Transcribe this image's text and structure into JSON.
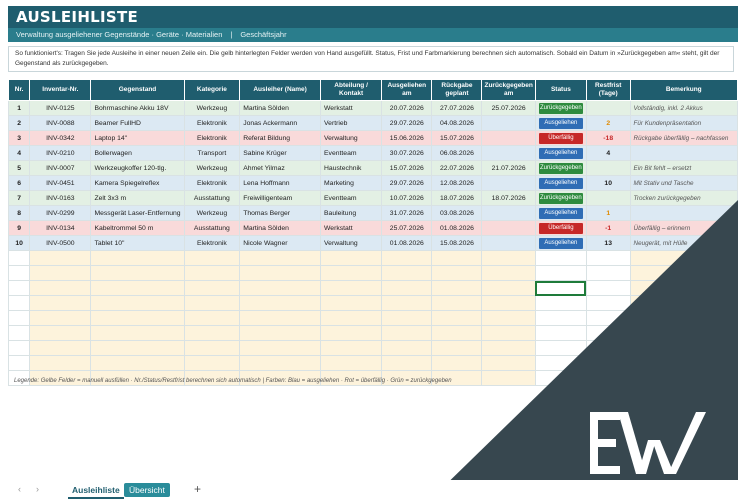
{
  "title": "AUSLEIHLISTE",
  "subtitle": "Verwaltung ausgeliehener Gegenstände · Geräte · Materialien",
  "subtitle_sep": "|",
  "subtitle_extra": "Geschäftsjahr",
  "howto": "So funktioniert's: Tragen Sie jede Ausleihe in einer neuen Zeile ein. Die gelb hinterlegten Felder werden von Hand ausgefüllt. Status, Frist und Farbmarkierung berechnen sich automatisch. Sobald ein Datum in »Zurückgegeben am« steht, gilt der Gegenstand als zurückgegeben.",
  "headers": [
    "Nr.",
    "Inventar-Nr.",
    "Gegenstand",
    "Kategorie",
    "Ausleiher (Name)",
    "Abteilung / Kontakt",
    "Ausgeliehen am",
    "Rückgabe geplant",
    "Zurückgegeben am",
    "Status",
    "Restfrist (Tage)",
    "Bemerkung"
  ],
  "rows": [
    {
      "nr": "1",
      "inv": "INV-0125",
      "item": "Bohrmaschine Akku 18V",
      "cat": "Werkzeug",
      "name": "Martina Sölden",
      "dept": "Werkstatt",
      "out": "20.07.2026",
      "due": "27.07.2026",
      "ret": "25.07.2026",
      "status": "Zurückgegeben",
      "rest": "",
      "note": "Vollständig, inkl. 2 Akkus",
      "cls": "g"
    },
    {
      "nr": "2",
      "inv": "INV-0088",
      "item": "Beamer FullHD",
      "cat": "Elektronik",
      "name": "Jonas Ackermann",
      "dept": "Vertrieb",
      "out": "29.07.2026",
      "due": "04.08.2026",
      "ret": "",
      "status": "Ausgeliehen",
      "rest": "2",
      "note": "Für Kundenpräsentation",
      "cls": "b"
    },
    {
      "nr": "3",
      "inv": "INV-0342",
      "item": "Laptop 14\"",
      "cat": "Elektronik",
      "name": "Referat Bildung",
      "dept": "Verwaltung",
      "out": "15.06.2026",
      "due": "15.07.2026",
      "ret": "",
      "status": "Überfällig",
      "rest": "-18",
      "note": "Rückgabe überfällig – nachfassen",
      "cls": "r"
    },
    {
      "nr": "4",
      "inv": "INV-0210",
      "item": "Bollerwagen",
      "cat": "Transport",
      "name": "Sabine Krüger",
      "dept": "Eventteam",
      "out": "30.07.2026",
      "due": "06.08.2026",
      "ret": "",
      "status": "Ausgeliehen",
      "rest": "4",
      "note": "",
      "cls": "b"
    },
    {
      "nr": "5",
      "inv": "INV-0007",
      "item": "Werkzeugkoffer 120-tlg.",
      "cat": "Werkzeug",
      "name": "Ahmet Yilmaz",
      "dept": "Haustechnik",
      "out": "15.07.2026",
      "due": "22.07.2026",
      "ret": "21.07.2026",
      "status": "Zurückgegeben",
      "rest": "",
      "note": "Ein Bit fehlt – ersetzt",
      "cls": "g"
    },
    {
      "nr": "6",
      "inv": "INV-0451",
      "item": "Kamera Spiegelreflex",
      "cat": "Elektronik",
      "name": "Lena Hoffmann",
      "dept": "Marketing",
      "out": "29.07.2026",
      "due": "12.08.2026",
      "ret": "",
      "status": "Ausgeliehen",
      "rest": "10",
      "note": "Mit Stativ und Tasche",
      "cls": "b"
    },
    {
      "nr": "7",
      "inv": "INV-0163",
      "item": "Zelt 3x3 m",
      "cat": "Ausstattung",
      "name": "Freiwilligenteam",
      "dept": "Eventteam",
      "out": "10.07.2026",
      "due": "18.07.2026",
      "ret": "18.07.2026",
      "status": "Zurückgegeben",
      "rest": "",
      "note": "Trocken zurückgegeben",
      "cls": "g"
    },
    {
      "nr": "8",
      "inv": "INV-0299",
      "item": "Messgerät Laser-Entfernung",
      "cat": "Werkzeug",
      "name": "Thomas Berger",
      "dept": "Bauleitung",
      "out": "31.07.2026",
      "due": "03.08.2026",
      "ret": "",
      "status": "Ausgeliehen",
      "rest": "1",
      "note": "",
      "cls": "b"
    },
    {
      "nr": "9",
      "inv": "INV-0134",
      "item": "Kabeltrommel 50 m",
      "cat": "Ausstattung",
      "name": "Martina Sölden",
      "dept": "Werkstatt",
      "out": "25.07.2026",
      "due": "01.08.2026",
      "ret": "",
      "status": "Überfällig",
      "rest": "-1",
      "note": "Überfällig – erinnern",
      "cls": "r"
    },
    {
      "nr": "10",
      "inv": "INV-0500",
      "item": "Tablet 10\"",
      "cat": "Elektronik",
      "name": "Nicole Wagner",
      "dept": "Verwaltung",
      "out": "01.08.2026",
      "due": "15.08.2026",
      "ret": "",
      "status": "Ausgeliehen",
      "rest": "13",
      "note": "Neugerät, mit Hülle",
      "cls": "b"
    }
  ],
  "empty_rows": 9,
  "legend": "Legende:  Gelbe Felder = manuell ausfüllen · Nr./Status/Restfrist berechnen sich automatisch   |   Farben:  Blau = ausgeliehen · Rot = überfällig · Grün = zurückgegeben",
  "tabs": {
    "active": "Ausleihliste",
    "second": "Übersicht",
    "add": "+"
  },
  "nav": {
    "prev": "‹",
    "next": "›"
  },
  "logo_text": "EW",
  "colors": {
    "header": "#1f5d6e",
    "returned": "#2e8b3e",
    "lent": "#2f6db5",
    "overdue": "#c62828",
    "corner": "#37474f"
  }
}
